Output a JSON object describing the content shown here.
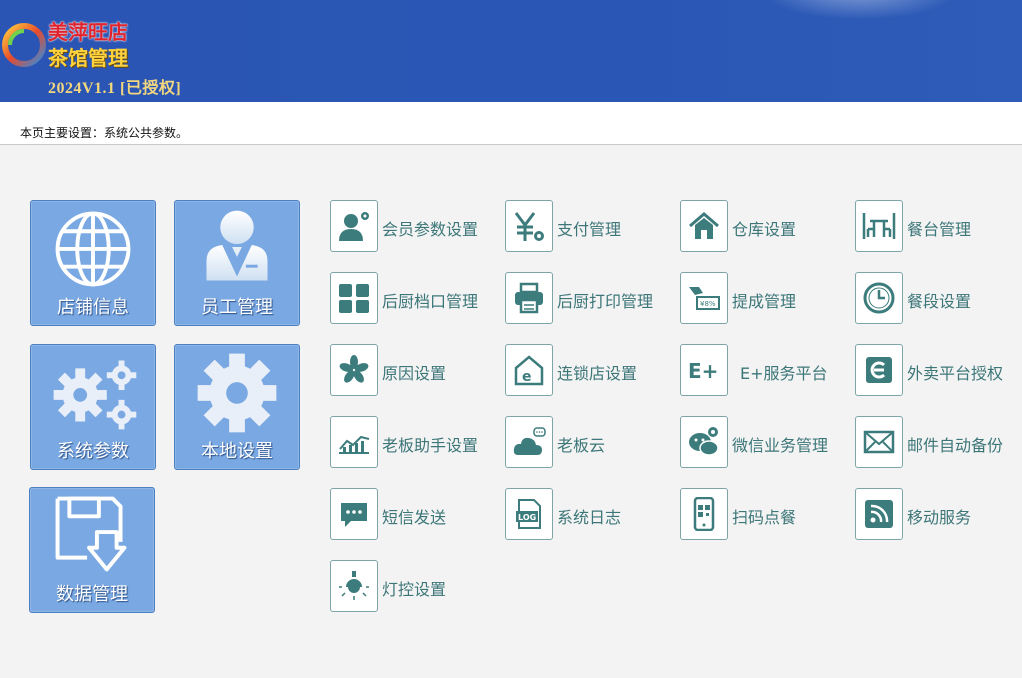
{
  "header": {
    "brand_line1": "美萍旺店",
    "brand_line2": "茶馆管理",
    "version": "2024V1.1 [已授权]"
  },
  "info": {
    "text": "本页主要设置：系统公共参数。"
  },
  "tiles": [
    {
      "label": "店铺信息",
      "icon": "globe-icon"
    },
    {
      "label": "员工管理",
      "icon": "staff-icon"
    },
    {
      "label": "系统参数",
      "icon": "gears-icon"
    },
    {
      "label": "本地设置",
      "icon": "gear-icon"
    },
    {
      "label": "数据管理",
      "icon": "disk-download-icon"
    }
  ],
  "items": [
    {
      "label": "会员参数设置",
      "icon": "member-settings-icon"
    },
    {
      "label": "支付管理",
      "icon": "yen-gear-icon"
    },
    {
      "label": "仓库设置",
      "icon": "house-icon"
    },
    {
      "label": "餐台管理",
      "icon": "table-icon"
    },
    {
      "label": "后厨档口管理",
      "icon": "grid-icon"
    },
    {
      "label": "后厨打印管理",
      "icon": "printer-icon"
    },
    {
      "label": "提成管理",
      "icon": "commission-icon"
    },
    {
      "label": "餐段设置",
      "icon": "clock-icon"
    },
    {
      "label": "原因设置",
      "icon": "asterisk-icon"
    },
    {
      "label": "连锁店设置",
      "icon": "chain-store-icon"
    },
    {
      "label": "E+服务平台",
      "icon": "e-plus-icon"
    },
    {
      "label": "外卖平台授权",
      "icon": "delivery-icon"
    },
    {
      "label": "老板助手设置",
      "icon": "chart-icon"
    },
    {
      "label": "老板云",
      "icon": "cloud-chat-icon"
    },
    {
      "label": "微信业务管理",
      "icon": "wechat-icon"
    },
    {
      "label": "邮件自动备份",
      "icon": "mail-icon"
    },
    {
      "label": "短信发送",
      "icon": "sms-icon"
    },
    {
      "label": "系统日志",
      "icon": "log-icon"
    },
    {
      "label": "扫码点餐",
      "icon": "phone-qr-icon"
    },
    {
      "label": "移动服务",
      "icon": "rss-icon"
    },
    {
      "label": "灯控设置",
      "icon": "light-icon"
    }
  ],
  "colors": {
    "header_bg": "#2b55b4",
    "tile_bg": "#7aa8e2",
    "item_text": "#3c7678",
    "icon_teal": "#3d7c7c"
  }
}
